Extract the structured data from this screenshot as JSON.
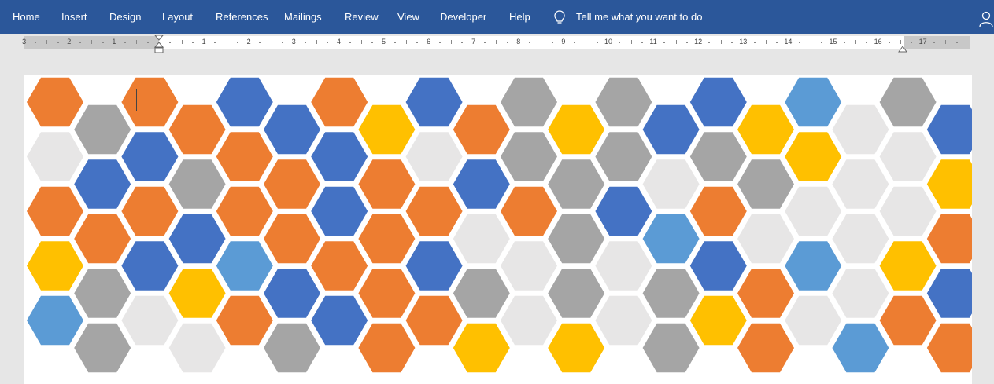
{
  "ribbon": {
    "tabs": [
      "Home",
      "Insert",
      "Design",
      "Layout",
      "References",
      "Mailings",
      "Review",
      "View",
      "Developer",
      "Help"
    ],
    "tell_me": "Tell me what you want to do",
    "lightbulb_icon": "lightbulb-icon",
    "account_icon": "person-icon"
  },
  "ruler": {
    "left_labels": [
      "3",
      "2",
      "1"
    ],
    "right_labels": [
      "1",
      "2",
      "3",
      "4",
      "5",
      "6",
      "7",
      "8",
      "9",
      "10",
      "11",
      "12",
      "13",
      "14",
      "15",
      "16",
      "17"
    ],
    "unit": "cm"
  },
  "colors": {
    "ribbon": "#2b579a",
    "orange": "#ed7d31",
    "blue": "#4472c4",
    "gray": "#a5a5a5",
    "light_gray": "#e7e6e6",
    "gold": "#ffc000",
    "light_blue": "#5b9bd5"
  },
  "document": {
    "pattern": "honeycomb",
    "hex_colors_by_column": [
      [
        "O",
        "L",
        "O",
        "Y",
        "B"
      ],
      [
        "G",
        "B",
        "O",
        "G",
        "G"
      ],
      [
        "O",
        "B",
        "O",
        "B",
        "L"
      ],
      [
        "O",
        "G",
        "B",
        "Y",
        "L"
      ],
      [
        "B",
        "O",
        "O",
        "B",
        "O"
      ],
      [
        "B",
        "O",
        "O",
        "B",
        "G"
      ],
      [
        "O",
        "B",
        "B",
        "O",
        "B"
      ],
      [
        "Y",
        "O",
        "O",
        "O",
        "O"
      ],
      [
        "B",
        "L",
        "O",
        "B",
        "O"
      ],
      [
        "O",
        "B",
        "L",
        "G",
        "Y"
      ],
      [
        "G",
        "G",
        "O",
        "L",
        "L"
      ],
      [
        "Y",
        "G",
        "G",
        "G",
        "Y"
      ],
      [
        "G",
        "G",
        "B",
        "L",
        "L"
      ],
      [
        "B",
        "L",
        "B",
        "G",
        "G"
      ],
      [
        "B",
        "G",
        "O",
        "B",
        "Y"
      ],
      [
        "Y",
        "G",
        "L",
        "O",
        "O"
      ],
      [
        "L",
        "Y",
        "L",
        "L",
        "L"
      ],
      [
        "L",
        "L",
        "L",
        "L",
        "L"
      ],
      [
        "G",
        "L",
        "L",
        "Y",
        "O"
      ],
      [
        "B",
        "Y",
        "O",
        "B",
        "O"
      ]
    ]
  }
}
